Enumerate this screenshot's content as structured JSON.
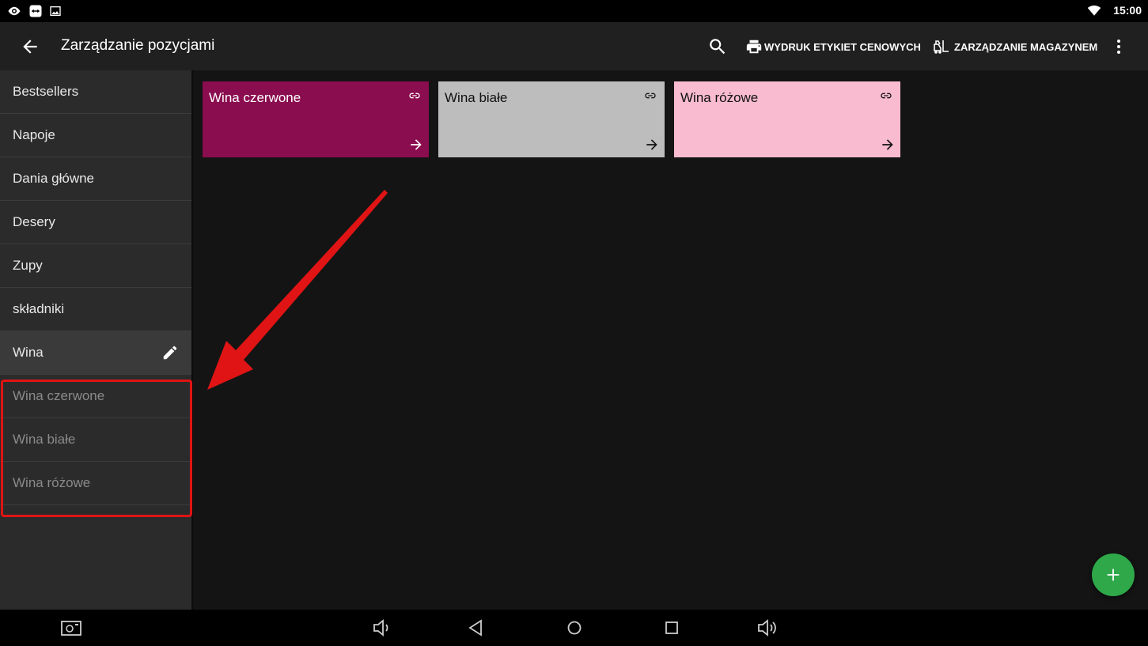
{
  "status_bar": {
    "time": "15:00"
  },
  "app_bar": {
    "title": "Zarządzanie pozycjami",
    "print_labels": "WYDRUK ETYKIET CENOWYCH",
    "stock_management": "ZARZĄDZANIE MAGAZYNEM"
  },
  "sidebar": {
    "items": [
      {
        "label": "Bestsellers"
      },
      {
        "label": "Napoje"
      },
      {
        "label": "Dania główne"
      },
      {
        "label": "Desery"
      },
      {
        "label": "Zupy"
      },
      {
        "label": "składniki"
      },
      {
        "label": "Wina"
      }
    ],
    "subitems": [
      {
        "label": "Wina czerwone"
      },
      {
        "label": "Wina białe"
      },
      {
        "label": "Wina różowe"
      }
    ]
  },
  "tiles": [
    {
      "label": "Wina czerwone",
      "color": "#8a0d4f",
      "text_color": "#ffffff"
    },
    {
      "label": "Wina białe",
      "color": "#bdbdbd",
      "text_color": "#111111"
    },
    {
      "label": "Wina różowe",
      "color": "#f8bbd0",
      "text_color": "#111111"
    }
  ],
  "colors": {
    "fab": "#2fa84a",
    "highlight": "#e01414",
    "background": "#141414",
    "sidebar": "#2b2b2b"
  },
  "icons": {
    "back": "arrow-left-icon",
    "search": "search-icon",
    "print": "printer-icon",
    "stock": "forklift-icon",
    "more": "more-vert-icon",
    "edit": "pencil-icon",
    "tile_link": "link-icon",
    "tile_arrow": "arrow-right-icon",
    "fab": "plus-icon"
  }
}
